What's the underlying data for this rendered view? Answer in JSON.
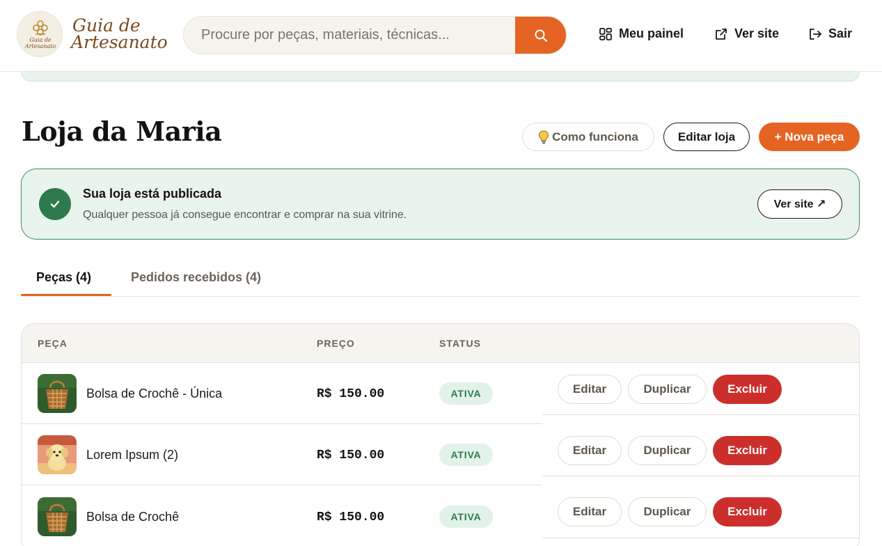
{
  "header": {
    "logo_line1": "Guia de",
    "logo_line2": "Artesanato",
    "logo_badge_line1": "Guia de",
    "logo_badge_line2": "Artesanato",
    "search_placeholder": "Procure por peças, materiais, técnicas...",
    "nav": {
      "panel": "Meu painel",
      "site": "Ver site",
      "logout": "Sair"
    },
    "accent_color": "#e56323"
  },
  "page": {
    "title": "Loja da Maria",
    "how_it_works": "Como funciona",
    "edit_store": "Editar loja",
    "new_piece": "+ Nova peça"
  },
  "published": {
    "title": "Sua loja está publicada",
    "subtitle": "Qualquer pessoa já consegue encontrar e comprar na sua vitrine.",
    "view_site": "Ver site ↗",
    "color": "#2e7a4e"
  },
  "tabs": [
    {
      "label": "Peças (4)",
      "active": true
    },
    {
      "label": "Pedidos recebidos (4)",
      "active": false
    }
  ],
  "table": {
    "columns": [
      "PEÇA",
      "PREÇO",
      "STATUS"
    ],
    "actions": {
      "edit": "Editar",
      "duplicate": "Duplicar",
      "delete": "Excluir"
    },
    "rows": [
      {
        "name": "Bolsa de Crochê - Única",
        "price": "R$ 150.00",
        "status": "ATIVA",
        "thumb": "bag-thumbnail"
      },
      {
        "name": "Lorem Ipsum (2)",
        "price": "R$ 150.00",
        "status": "ATIVA",
        "thumb": "plush-thumbnail"
      },
      {
        "name": "Bolsa de Crochê",
        "price": "R$ 150.00",
        "status": "ATIVA",
        "thumb": "bag-thumbnail"
      }
    ]
  }
}
